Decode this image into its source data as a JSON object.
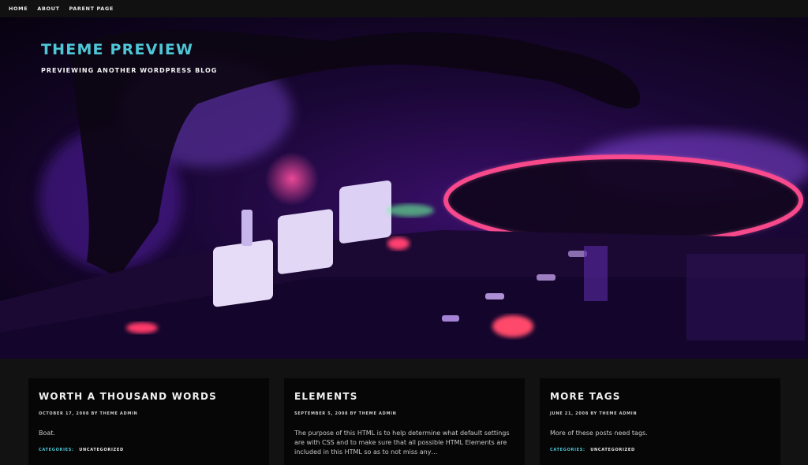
{
  "nav": {
    "items": [
      "Home",
      "About",
      "Parent Page"
    ]
  },
  "site": {
    "title": "THEME PREVIEW",
    "description": "PREVIEWING ANOTHER WORDPRESS BLOG"
  },
  "colors": {
    "accent": "#4fc6d6",
    "background": "#121212",
    "card": "#060606"
  },
  "posts": [
    {
      "title": "WORTH A THOUSAND WORDS",
      "meta": "OCTOBER 17, 2008 BY THEME ADMIN",
      "excerpt": "Boat.",
      "categories_label": "CATEGORIES:",
      "category": "UNCATEGORIZED"
    },
    {
      "title": "ELEMENTS",
      "meta": "SEPTEMBER 5, 2008 BY THEME ADMIN",
      "excerpt": "The purpose of this HTML is to help determine what default settings are with CSS and to make sure that all possible HTML Elements are included in this HTML so as to not miss any…"
    },
    {
      "title": "MORE TAGS",
      "meta": "JUNE 21, 2008 BY THEME ADMIN",
      "excerpt": "More of these posts need tags.",
      "categories_label": "CATEGORIES:",
      "category": "UNCATEGORIZED"
    }
  ]
}
